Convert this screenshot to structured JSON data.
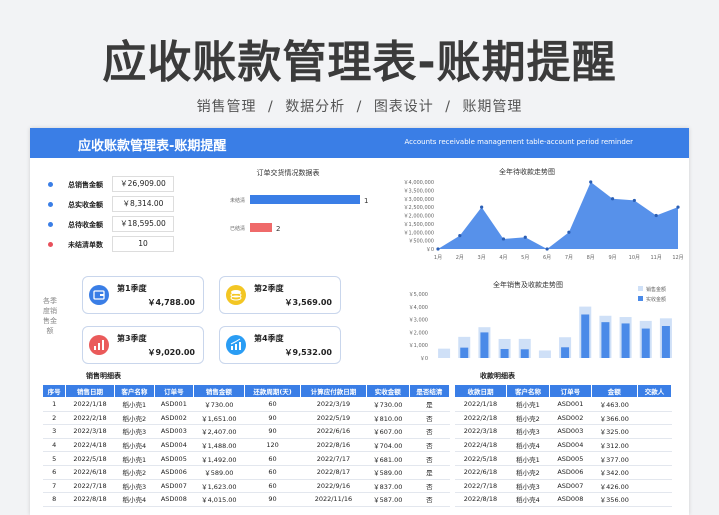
{
  "hero": {
    "title": "应收账款管理表-账期提醒",
    "tags": [
      "销售管理",
      "数据分析",
      "图表设计",
      "账期管理"
    ],
    "separator": "/"
  },
  "banner": {
    "title": "应收账款管理表-账期提醒",
    "subtitle": "Accounts receivable management table-account period reminder"
  },
  "kpis": [
    {
      "label": "总销售金额",
      "value": "￥26,909.00",
      "color": "#3a7ee6"
    },
    {
      "label": "总实收金额",
      "value": "￥8,314.00",
      "color": "#3a7ee6"
    },
    {
      "label": "总待收金额",
      "value": "￥18,595.00",
      "color": "#3a7ee6"
    },
    {
      "label": "未结清单数",
      "value": "10",
      "color": "#e8505b"
    }
  ],
  "order_chart": {
    "title": "订单交货情况数据表",
    "rows": [
      {
        "label": "未结清",
        "value": 10,
        "color": "#3a7ee6"
      },
      {
        "label": "已结清",
        "value": 2,
        "color": "#ef6a6a"
      }
    ]
  },
  "chart_data": [
    {
      "type": "area",
      "title": "全年待收款走势图",
      "categories": [
        "1月",
        "2月",
        "3月",
        "4月",
        "5月",
        "6月",
        "7月",
        "8月",
        "9月",
        "10月",
        "11月",
        "12月"
      ],
      "values": [
        0,
        800,
        2500,
        600,
        700,
        0,
        1000,
        4000,
        3000,
        2900,
        2000,
        2500
      ],
      "ylim": [
        0,
        4000
      ],
      "yticks": [
        "￥0",
        "￥500,000",
        "￥1,000,000",
        "￥1,500,000",
        "￥2,000,000",
        "￥2,500,000",
        "￥3,000,000",
        "￥3,500,000",
        "￥4,000,000"
      ],
      "color": "#3a7ee6"
    },
    {
      "type": "bar",
      "title": "全年销售及收款走势图",
      "categories": [
        "1",
        "2",
        "3",
        "4",
        "5",
        "6",
        "7",
        "8",
        "9",
        "10",
        "11",
        "12"
      ],
      "series": [
        {
          "name": "销售金额",
          "values": [
            730,
            1651,
            2407,
            1488,
            1492,
            589,
            1623,
            4015,
            3300,
            3200,
            2900,
            3100
          ],
          "color": "#cfe0f7"
        },
        {
          "name": "实收金额",
          "values": [
            0,
            810,
            2000,
            704,
            681,
            0,
            837,
            3400,
            2800,
            2700,
            2300,
            2500
          ],
          "color": "#4a8ae8"
        }
      ],
      "ylim": [
        0,
        5000
      ],
      "yticks": [
        "￥0",
        "￥1,000",
        "￥2,000",
        "￥3,000",
        "￥4,000",
        "￥5,000"
      ]
    }
  ],
  "quarters": [
    {
      "name": "第1季度",
      "value": "￥4,788.00",
      "color": "#3a7ee6",
      "icon": "wallet-icon"
    },
    {
      "name": "第2季度",
      "value": "￥3,569.00",
      "color": "#f3c623",
      "icon": "coins-icon"
    },
    {
      "name": "第3季度",
      "value": "￥9,020.00",
      "color": "#ea5a5a",
      "icon": "bar-chart-icon"
    },
    {
      "name": "第4季度",
      "value": "￥9,532.00",
      "color": "#2a9df4",
      "icon": "growth-chart-icon"
    }
  ],
  "side_label": "各季度销售金额",
  "sales_table": {
    "title": "销售明细表",
    "headers": [
      "序号",
      "销售日期",
      "客户名称",
      "订单号",
      "销售金额",
      "还款周期(天)",
      "计算应付款日期",
      "实收金额",
      "是否结清"
    ],
    "rows": [
      [
        "1",
        "2022/1/18",
        "稻小壳1",
        "ASD001",
        "￥730.00",
        "60",
        "2022/3/19",
        "￥730.00",
        "是"
      ],
      [
        "2",
        "2022/2/18",
        "稻小壳2",
        "ASD002",
        "￥1,651.00",
        "90",
        "2022/5/19",
        "￥810.00",
        "否"
      ],
      [
        "3",
        "2022/3/18",
        "稻小壳3",
        "ASD003",
        "￥2,407.00",
        "90",
        "2022/6/16",
        "￥607.00",
        "否"
      ],
      [
        "4",
        "2022/4/18",
        "稻小壳4",
        "ASD004",
        "￥1,488.00",
        "120",
        "2022/8/16",
        "￥704.00",
        "否"
      ],
      [
        "5",
        "2022/5/18",
        "稻小壳1",
        "ASD005",
        "￥1,492.00",
        "60",
        "2022/7/17",
        "￥681.00",
        "否"
      ],
      [
        "6",
        "2022/6/18",
        "稻小壳2",
        "ASD006",
        "￥589.00",
        "60",
        "2022/8/17",
        "￥589.00",
        "是"
      ],
      [
        "7",
        "2022/7/18",
        "稻小壳3",
        "ASD007",
        "￥1,623.00",
        "60",
        "2022/9/16",
        "￥837.00",
        "否"
      ],
      [
        "8",
        "2022/8/18",
        "稻小壳4",
        "ASD008",
        "￥4,015.00",
        "90",
        "2022/11/16",
        "￥587.00",
        "否"
      ]
    ]
  },
  "receipt_table": {
    "title": "收款明细表",
    "headers": [
      "收款日期",
      "客户名称",
      "订单号",
      "金额",
      "交款人"
    ],
    "rows": [
      [
        "2022/1/18",
        "稻小壳1",
        "ASD001",
        "￥463.00",
        ""
      ],
      [
        "2022/2/18",
        "稻小壳2",
        "ASD002",
        "￥366.00",
        ""
      ],
      [
        "2022/3/18",
        "稻小壳3",
        "ASD003",
        "￥325.00",
        ""
      ],
      [
        "2022/4/18",
        "稻小壳4",
        "ASD004",
        "￥312.00",
        ""
      ],
      [
        "2022/5/18",
        "稻小壳1",
        "ASD005",
        "￥377.00",
        ""
      ],
      [
        "2022/6/18",
        "稻小壳2",
        "ASD006",
        "￥342.00",
        ""
      ],
      [
        "2022/7/18",
        "稻小壳3",
        "ASD007",
        "￥426.00",
        ""
      ],
      [
        "2022/8/18",
        "稻小壳4",
        "ASD008",
        "￥356.00",
        ""
      ]
    ]
  }
}
